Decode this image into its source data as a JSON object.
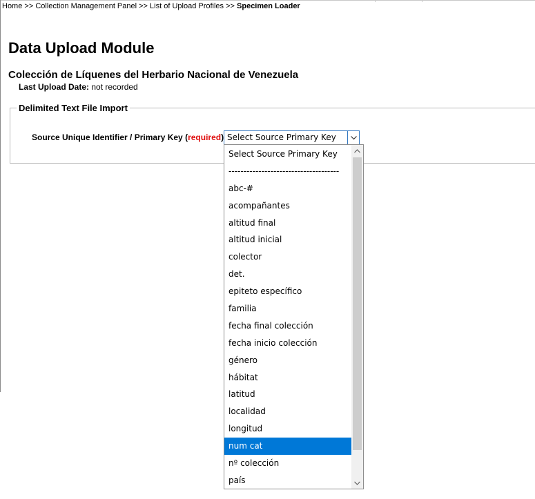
{
  "breadcrumb": {
    "home": "Home",
    "sep1": " >> ",
    "panel": "Collection Management Panel",
    "sep2": " >> ",
    "profiles": "List of Upload Profiles",
    "sep3": " >> ",
    "current": "Specimen Loader"
  },
  "page": {
    "title": "Data Upload Module",
    "collection": "Colección de Líquenes del Herbario Nacional de Venezuela",
    "upload_date_label": "Last Upload Date:",
    "upload_date_value": " not recorded"
  },
  "import": {
    "legend": "Delimited Text File Import",
    "pk_label": "Source Unique Identifier / Primary Key (",
    "pk_required": "required",
    "pk_label_end": "):",
    "selected_value": "Select Source Primary Key",
    "selected_index": 15,
    "options": [
      "Select Source Primary Key",
      "-------------------------------------",
      "abc-#",
      "acompañantes",
      "altitud final",
      "altitud inicial",
      "colector",
      "det.",
      "epiteto específico",
      "familia",
      "fecha final colección",
      "fecha inicio colección",
      "género",
      "hábitat",
      "latitud",
      "localidad",
      "longitud",
      "num cat",
      "nº colección",
      "país"
    ]
  },
  "icons": {
    "select_arrow": "chevron-down-icon",
    "scroll_up": "scroll-up-arrow-icon",
    "scroll_down": "scroll-down-arrow-icon"
  },
  "colors": {
    "highlight": "#0078d7",
    "required": "#e01010",
    "select_border": "#3478c0"
  }
}
